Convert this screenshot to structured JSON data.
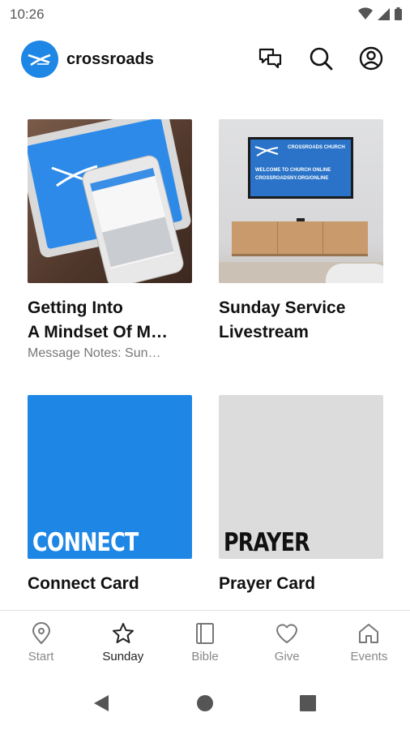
{
  "status_bar": {
    "time": "10:26",
    "icons": [
      "wifi-icon",
      "cell-signal-icon",
      "battery-icon"
    ]
  },
  "header": {
    "app_name": "crossroads",
    "logo_icon": "crossroads-logo-icon",
    "actions": [
      "chat-icon",
      "search-icon",
      "account-icon"
    ]
  },
  "cards": [
    {
      "title": "Getting Into\nA Mindset Of M…",
      "subtitle": "Message Notes: Sun…"
    },
    {
      "title": "Sunday Service\nLivestream",
      "subtitle": "",
      "screen": {
        "church": "CROSSROADS CHURCH",
        "line1": "WELCOME TO CHURCH ONLINE",
        "line2": "CROSSROADSNY.ORG/ONLINE"
      }
    },
    {
      "title": "Connect Card",
      "subtitle": "",
      "tile_text": "CONNECT",
      "tile_color": "#1e87e5"
    },
    {
      "title": "Prayer Card",
      "subtitle": "",
      "tile_text": "PRAYER",
      "tile_color": "#dcdcdc"
    }
  ],
  "bottom_nav": {
    "active": "Sunday",
    "items": [
      {
        "label": "Start",
        "icon": "location-pin-icon"
      },
      {
        "label": "Sunday",
        "icon": "star-icon"
      },
      {
        "label": "Bible",
        "icon": "book-icon"
      },
      {
        "label": "Give",
        "icon": "heart-icon"
      },
      {
        "label": "Events",
        "icon": "home-icon"
      }
    ]
  },
  "system_nav": [
    "back-icon",
    "home-circle-icon",
    "recents-icon"
  ],
  "colors": {
    "accent": "#1e87e5",
    "tile_gray": "#dcdcdc",
    "text": "#111111",
    "muted": "#777777"
  }
}
